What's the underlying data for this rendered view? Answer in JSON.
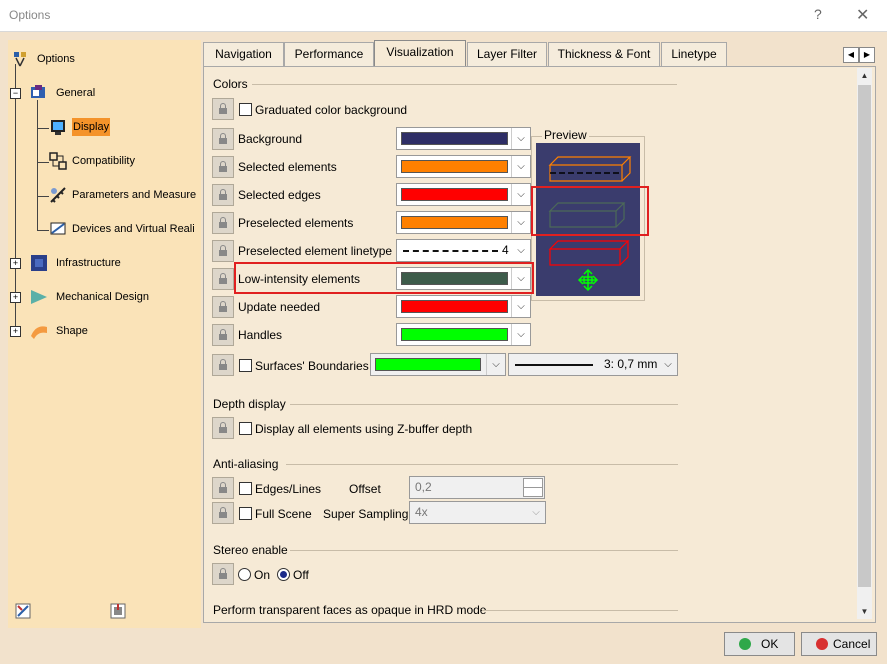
{
  "window": {
    "title": "Options",
    "help": "?",
    "close": "✕"
  },
  "tree": {
    "root": "Options",
    "items": [
      {
        "label": "General"
      },
      {
        "label": "Display"
      },
      {
        "label": "Compatibility"
      },
      {
        "label": "Parameters and Measure"
      },
      {
        "label": "Devices and Virtual Reali"
      },
      {
        "label": "Infrastructure"
      },
      {
        "label": "Mechanical Design"
      },
      {
        "label": "Shape"
      }
    ],
    "expand": "+",
    "collapse": "−"
  },
  "tabs": [
    "Navigation",
    "Performance",
    "Visualization",
    "Layer Filter",
    "Thickness & Font",
    "Linetype"
  ],
  "tab_arrows": {
    "left": "◀",
    "right": "▶"
  },
  "colors": {
    "section": "Colors",
    "graduated": "Graduated color background",
    "rows": [
      {
        "label": "Background",
        "color": "#2e2e66"
      },
      {
        "label": "Selected elements",
        "color": "#ff8000"
      },
      {
        "label": "Selected edges",
        "color": "#ff0000"
      },
      {
        "label": "Preselected elements",
        "color": "#ff8000"
      },
      {
        "label": "Preselected element linetype",
        "linetype": "4"
      },
      {
        "label": "Low-intensity elements",
        "color": "#3d5c4b"
      },
      {
        "label": "Update needed",
        "color": "#ff0000"
      },
      {
        "label": "Handles",
        "color": "#00ff00"
      }
    ],
    "surfaces": "Surfaces' Boundaries",
    "surfaces_color": "#00ff00",
    "surfaces_thickness": "3: 0,7 mm",
    "preview": "Preview"
  },
  "depth": {
    "section": "Depth display",
    "option": "Display all elements using Z-buffer depth"
  },
  "antialias": {
    "section": "Anti-aliasing",
    "edges": "Edges/Lines",
    "offset_label": "Offset",
    "offset_value": "0,2",
    "full_scene": "Full Scene",
    "super_label": "Super Sampling",
    "super_value": "4x"
  },
  "stereo": {
    "section": "Stereo enable",
    "on": "On",
    "off": "Off"
  },
  "transparent": "Perform transparent faces as opaque in HRD mode",
  "scroll": {
    "up": "▲",
    "down": "▼"
  },
  "combo_arrow": "⌵",
  "buttons": {
    "ok": "OK",
    "cancel": "Cancel"
  }
}
